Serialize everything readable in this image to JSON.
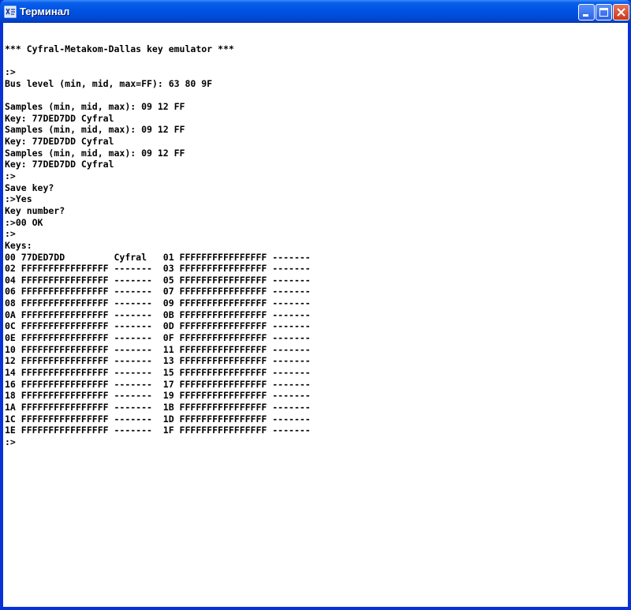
{
  "window": {
    "title": "Терминал"
  },
  "terminal": {
    "lines": [
      "*** Cyfral-Metakom-Dallas key emulator ***",
      "",
      ":>",
      "Bus level (min, mid, max=FF): 63 80 9F",
      "",
      "Samples (min, mid, max): 09 12 FF",
      "Key: 77DED7DD Cyfral",
      "Samples (min, mid, max): 09 12 FF",
      "Key: 77DED7DD Cyfral",
      "Samples (min, mid, max): 09 12 FF",
      "Key: 77DED7DD Cyfral",
      ":>",
      "Save key?",
      ":>Yes",
      "Key number?",
      ":>00 OK",
      ":>",
      "Keys:",
      "00 77DED7DD         Cyfral   01 FFFFFFFFFFFFFFFF -------",
      "02 FFFFFFFFFFFFFFFF -------  03 FFFFFFFFFFFFFFFF -------",
      "04 FFFFFFFFFFFFFFFF -------  05 FFFFFFFFFFFFFFFF -------",
      "06 FFFFFFFFFFFFFFFF -------  07 FFFFFFFFFFFFFFFF -------",
      "08 FFFFFFFFFFFFFFFF -------  09 FFFFFFFFFFFFFFFF -------",
      "0A FFFFFFFFFFFFFFFF -------  0B FFFFFFFFFFFFFFFF -------",
      "0C FFFFFFFFFFFFFFFF -------  0D FFFFFFFFFFFFFFFF -------",
      "0E FFFFFFFFFFFFFFFF -------  0F FFFFFFFFFFFFFFFF -------",
      "10 FFFFFFFFFFFFFFFF -------  11 FFFFFFFFFFFFFFFF -------",
      "12 FFFFFFFFFFFFFFFF -------  13 FFFFFFFFFFFFFFFF -------",
      "14 FFFFFFFFFFFFFFFF -------  15 FFFFFFFFFFFFFFFF -------",
      "16 FFFFFFFFFFFFFFFF -------  17 FFFFFFFFFFFFFFFF -------",
      "18 FFFFFFFFFFFFFFFF -------  19 FFFFFFFFFFFFFFFF -------",
      "1A FFFFFFFFFFFFFFFF -------  1B FFFFFFFFFFFFFFFF -------",
      "1C FFFFFFFFFFFFFFFF -------  1D FFFFFFFFFFFFFFFF -------",
      "1E FFFFFFFFFFFFFFFF -------  1F FFFFFFFFFFFFFFFF -------",
      ":>"
    ]
  }
}
